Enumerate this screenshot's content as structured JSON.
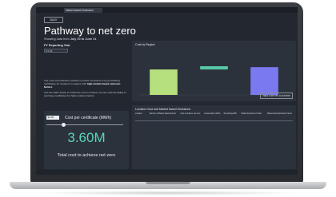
{
  "app": {
    "brand": "",
    "tab_title": "Market based Emissions",
    "top_right": ""
  },
  "page": {
    "back_label": "BACK",
    "title": "Pathway to net zero",
    "subtitle_prefix": "Showing data from ",
    "subtitle_range": "July 20 to June 21",
    "fy_label": "FY Reporting Year",
    "fy_value": "FY 21"
  },
  "description": {
    "p1_text": "The most cost-effective method to reduce emissions is by purchasing certificates for locations in regions with ",
    "p1_bold": "high market based emission factors",
    "p2_text": "Use the slider below to model the cost to achieve net zero and the ability to purchase certificates for high emission factors."
  },
  "kpi": {
    "input_value": "$3.85",
    "cost_label": "Cost per certificate (MWh)",
    "slider_position": 0.22,
    "value": "3.60M",
    "caption": "Total cost to achieve net zero"
  },
  "chart_data": {
    "type": "bar",
    "title": "Cost by Region",
    "xlabel": "",
    "ylabel": "",
    "colors": [
      "#b6e07d",
      "#56c9a6",
      "#7b79f0"
    ],
    "bars": [
      {
        "start": 0,
        "end": 0.55,
        "color": "#b6e07d"
      },
      {
        "start": 0.55,
        "end": 0.62,
        "color": "#56c9a6"
      },
      {
        "start": 0,
        "end": 0.6,
        "color": "#7b79f0"
      }
    ],
    "button": "VIEW COST BY LOCATION"
  },
  "table": {
    "title": "Location Cost and Market based Emissions",
    "headers": [
      "Location",
      "Number of Market based Entries",
      "Cost to achieve net zero",
      "Consumption (kWh)",
      "Remaining kWh",
      "Market Emissions tCO2e",
      "Market based Emission Factor"
    ],
    "rows": []
  },
  "footer": {
    "brand": ""
  }
}
